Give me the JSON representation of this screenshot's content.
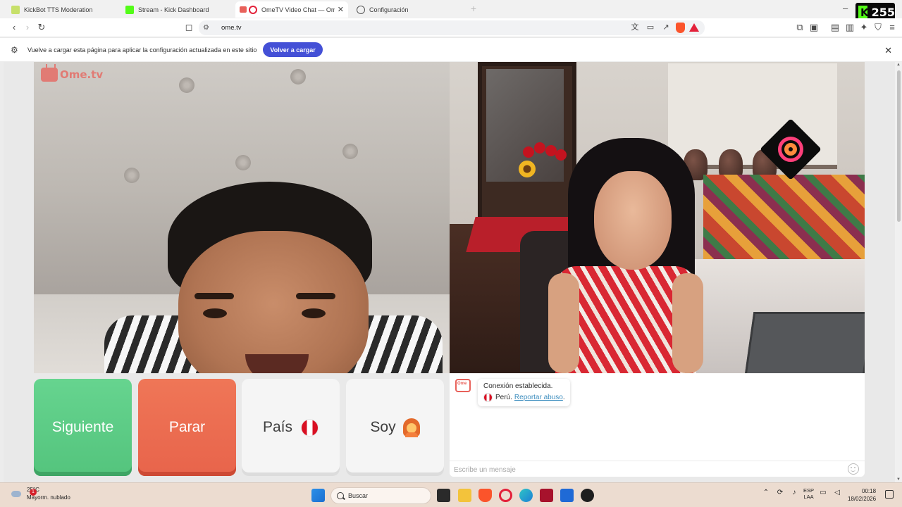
{
  "browser": {
    "tabs": [
      {
        "title": "KickBot TTS Moderation",
        "active": false
      },
      {
        "title": "Stream - Kick Dashboard",
        "active": false
      },
      {
        "title": "OmeTV Video Chat — Omegle alternativ",
        "active": true
      },
      {
        "title": "Configuración",
        "active": false
      }
    ],
    "address": {
      "url": "ome.tv"
    },
    "kick_counter": "255"
  },
  "infobar": {
    "message": "Vuelve a cargar esta página para aplicar la configuración actualizada en este sitio",
    "reload_label": "Volver a cargar"
  },
  "ometv": {
    "watermark": "Ome.tv",
    "controls": {
      "next_label": "Siguiente",
      "stop_label": "Parar",
      "country_label": "País",
      "gender_label": "Soy"
    },
    "chat": {
      "status_message": "Conexión establecida.",
      "country": "Perú.",
      "report_label": "Reportar abuso",
      "report_suffix": ".",
      "input_placeholder": "Escribe un mensaje"
    }
  },
  "taskbar": {
    "weather": {
      "temp": "25°C",
      "condition": "Mayorm. nublado",
      "badge": "1"
    },
    "search_label": "Buscar",
    "lang": {
      "line1": "ESP",
      "line2": "LAA"
    },
    "clock": {
      "time": "00:18",
      "date": "18/02/2026"
    }
  },
  "colors": {
    "next_green": "#5cc886",
    "stop_red": "#ea6a4f",
    "accent_blue": "#4450d6",
    "kick_green": "#53fc18"
  }
}
